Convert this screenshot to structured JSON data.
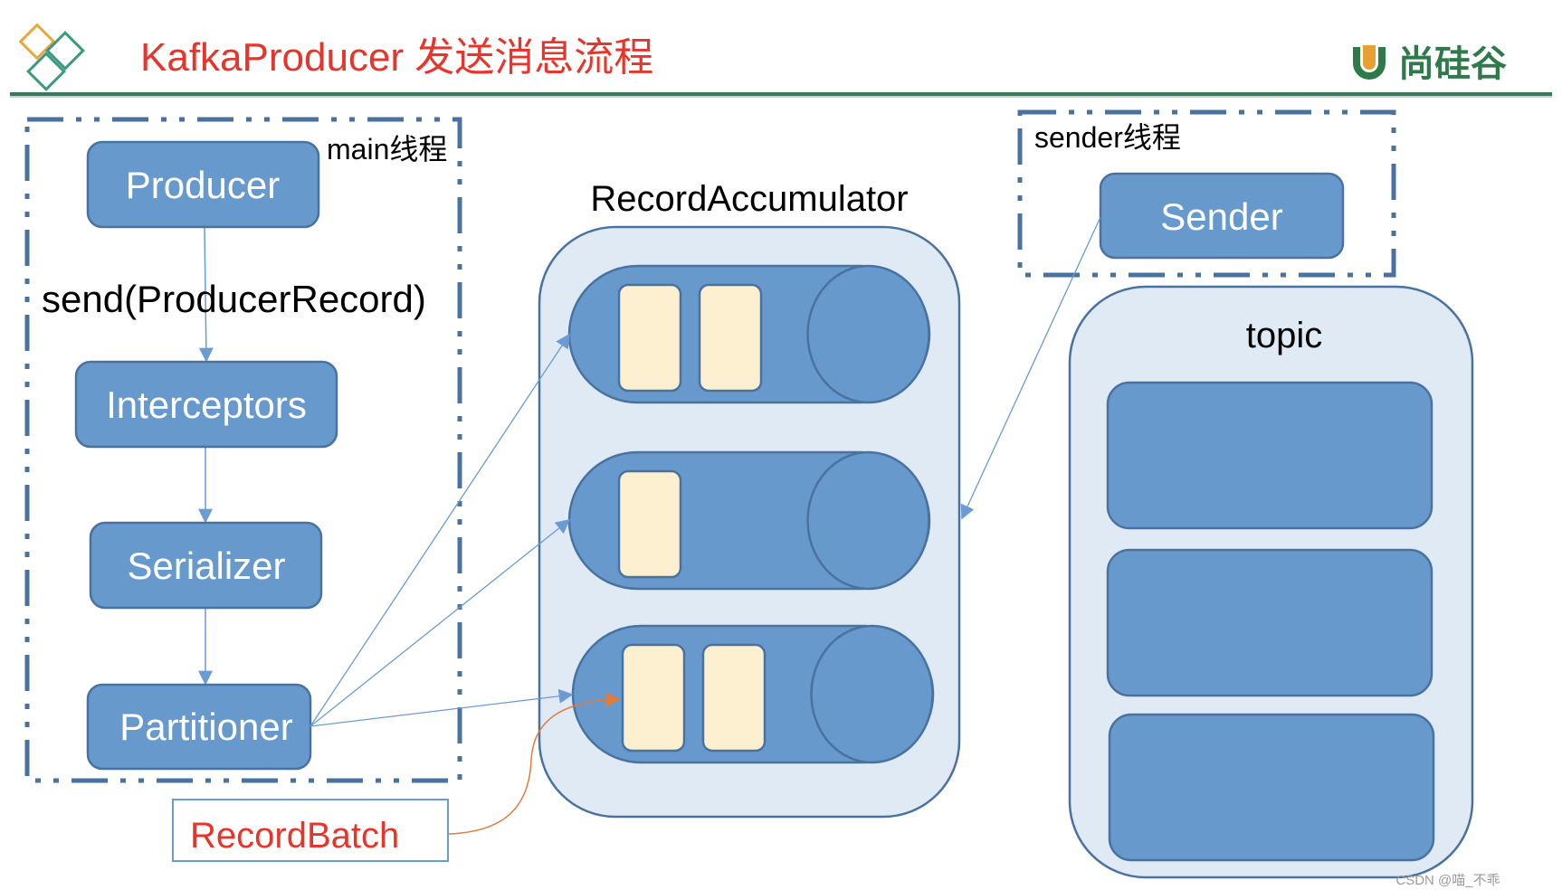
{
  "header": {
    "title": "KafkaProducer 发送消息流程",
    "brand_text": "尚硅谷",
    "brand_icon": "u-logo-icon",
    "corner_icon": "diamond-logo-icon"
  },
  "main_thread": {
    "label": "main线程",
    "call_label": "send(ProducerRecord)",
    "steps": [
      "Producer",
      "Interceptors",
      "Serializer",
      "Partitioner"
    ]
  },
  "accumulator": {
    "label": "RecordAccumulator",
    "queues": [
      {
        "batches": 2
      },
      {
        "batches": 1
      },
      {
        "batches": 2
      }
    ]
  },
  "record_batch": {
    "label": "RecordBatch"
  },
  "sender_thread": {
    "label": "sender线程",
    "node": "Sender"
  },
  "topic": {
    "label": "topic",
    "partitions": 3
  },
  "watermark": "CSDN @喵_不乖",
  "colors": {
    "title": "#e8352b",
    "node_fill": "#6799cd",
    "node_stroke": "#4a72a0",
    "container_fill": "#e0eaf5",
    "batch_fill": "#fdf0d0",
    "dash_border": "#4a72a0",
    "arrow": "#6a9bd2",
    "orange_arrow": "#e07b3a",
    "brand_green": "#2f7a4b",
    "brand_orange": "#e8a030"
  }
}
